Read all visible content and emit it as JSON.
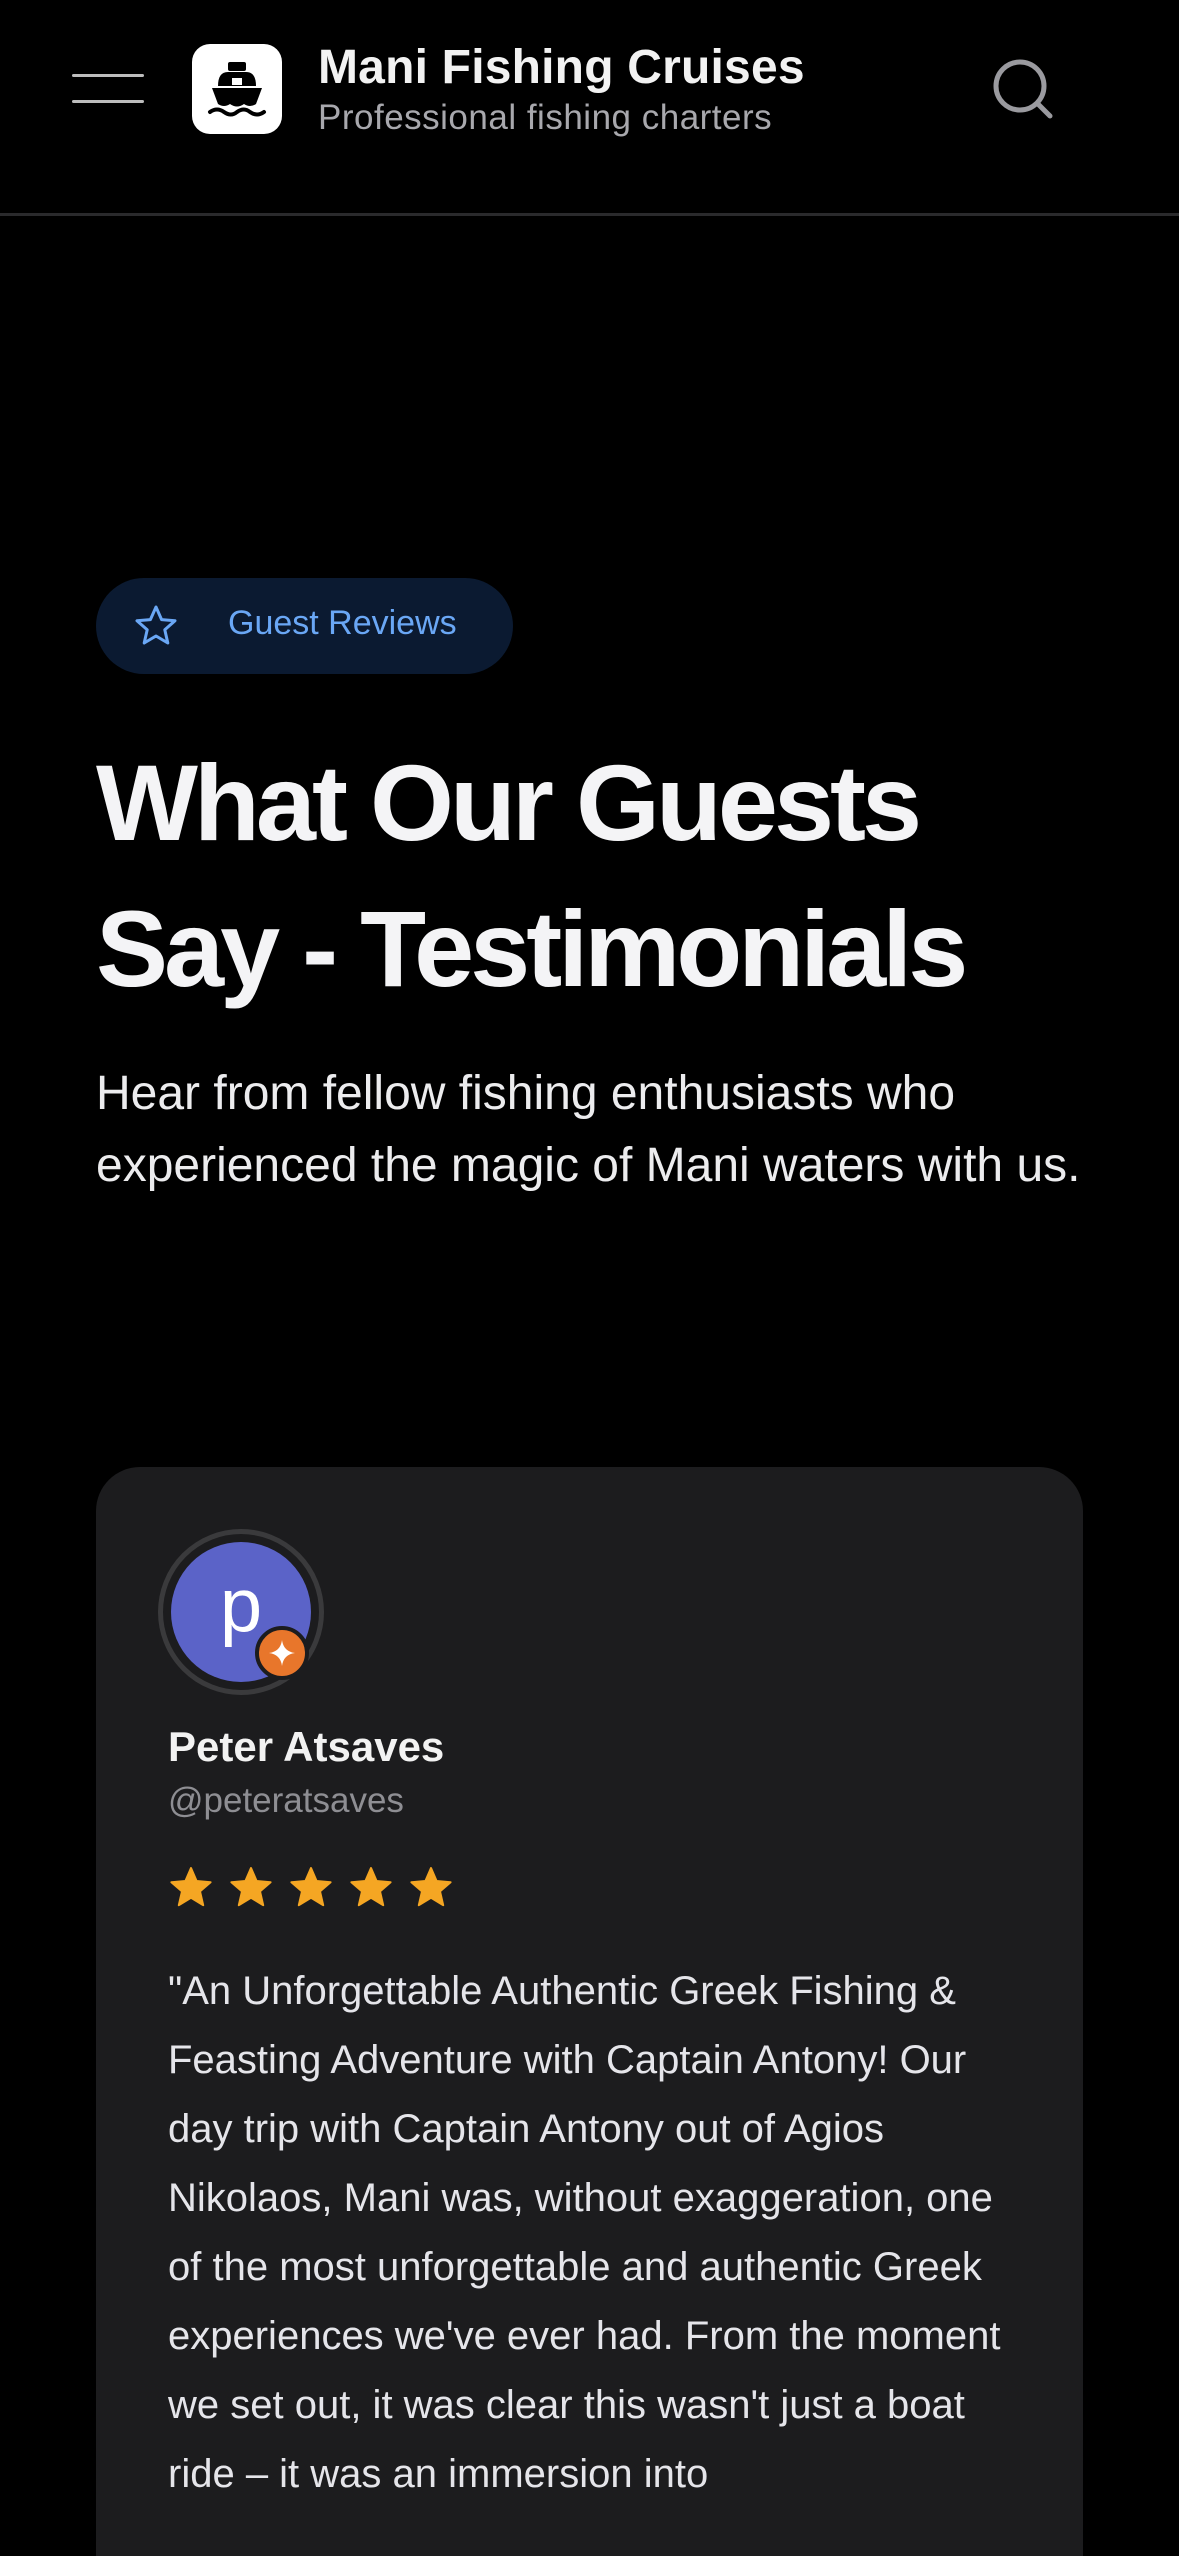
{
  "header": {
    "brand_title": "Mani Fishing Cruises",
    "brand_subtitle": "Professional fishing charters",
    "icons": {
      "menu": "hamburger-menu-icon",
      "logo": "ship-icon",
      "search": "search-icon"
    }
  },
  "badge": {
    "label": "Guest Reviews",
    "icon": "star-outline-icon",
    "color": "#6aa7f5"
  },
  "section": {
    "title_line1": "What Our Guests",
    "title_line2": "Say - Testimonials",
    "intro": "Hear from fellow fishing enthusiasts who experienced the magic of Mani waters with us."
  },
  "testimonial": {
    "avatar_letter": "p",
    "avatar_color": "#5b63c8",
    "badge_color": "#e8762b",
    "name": "Peter Atsaves",
    "handle": "@peteratsaves",
    "rating": 5,
    "star_color": "#f5a623",
    "text": "\"An Unforgettable Authentic Greek Fishing & Feasting Adventure with Captain Antony! Our day trip with Captain Antony out of Agios Nikolaos, Mani was, without exaggeration, one of the most unforgettable and authentic Greek experiences we've ever had. From the moment we set out, it was clear this wasn't just a boat ride – it was an immersion into"
  },
  "colors": {
    "background": "#000000",
    "card": "#1c1c1e",
    "badge_bg": "#0b1a31"
  }
}
